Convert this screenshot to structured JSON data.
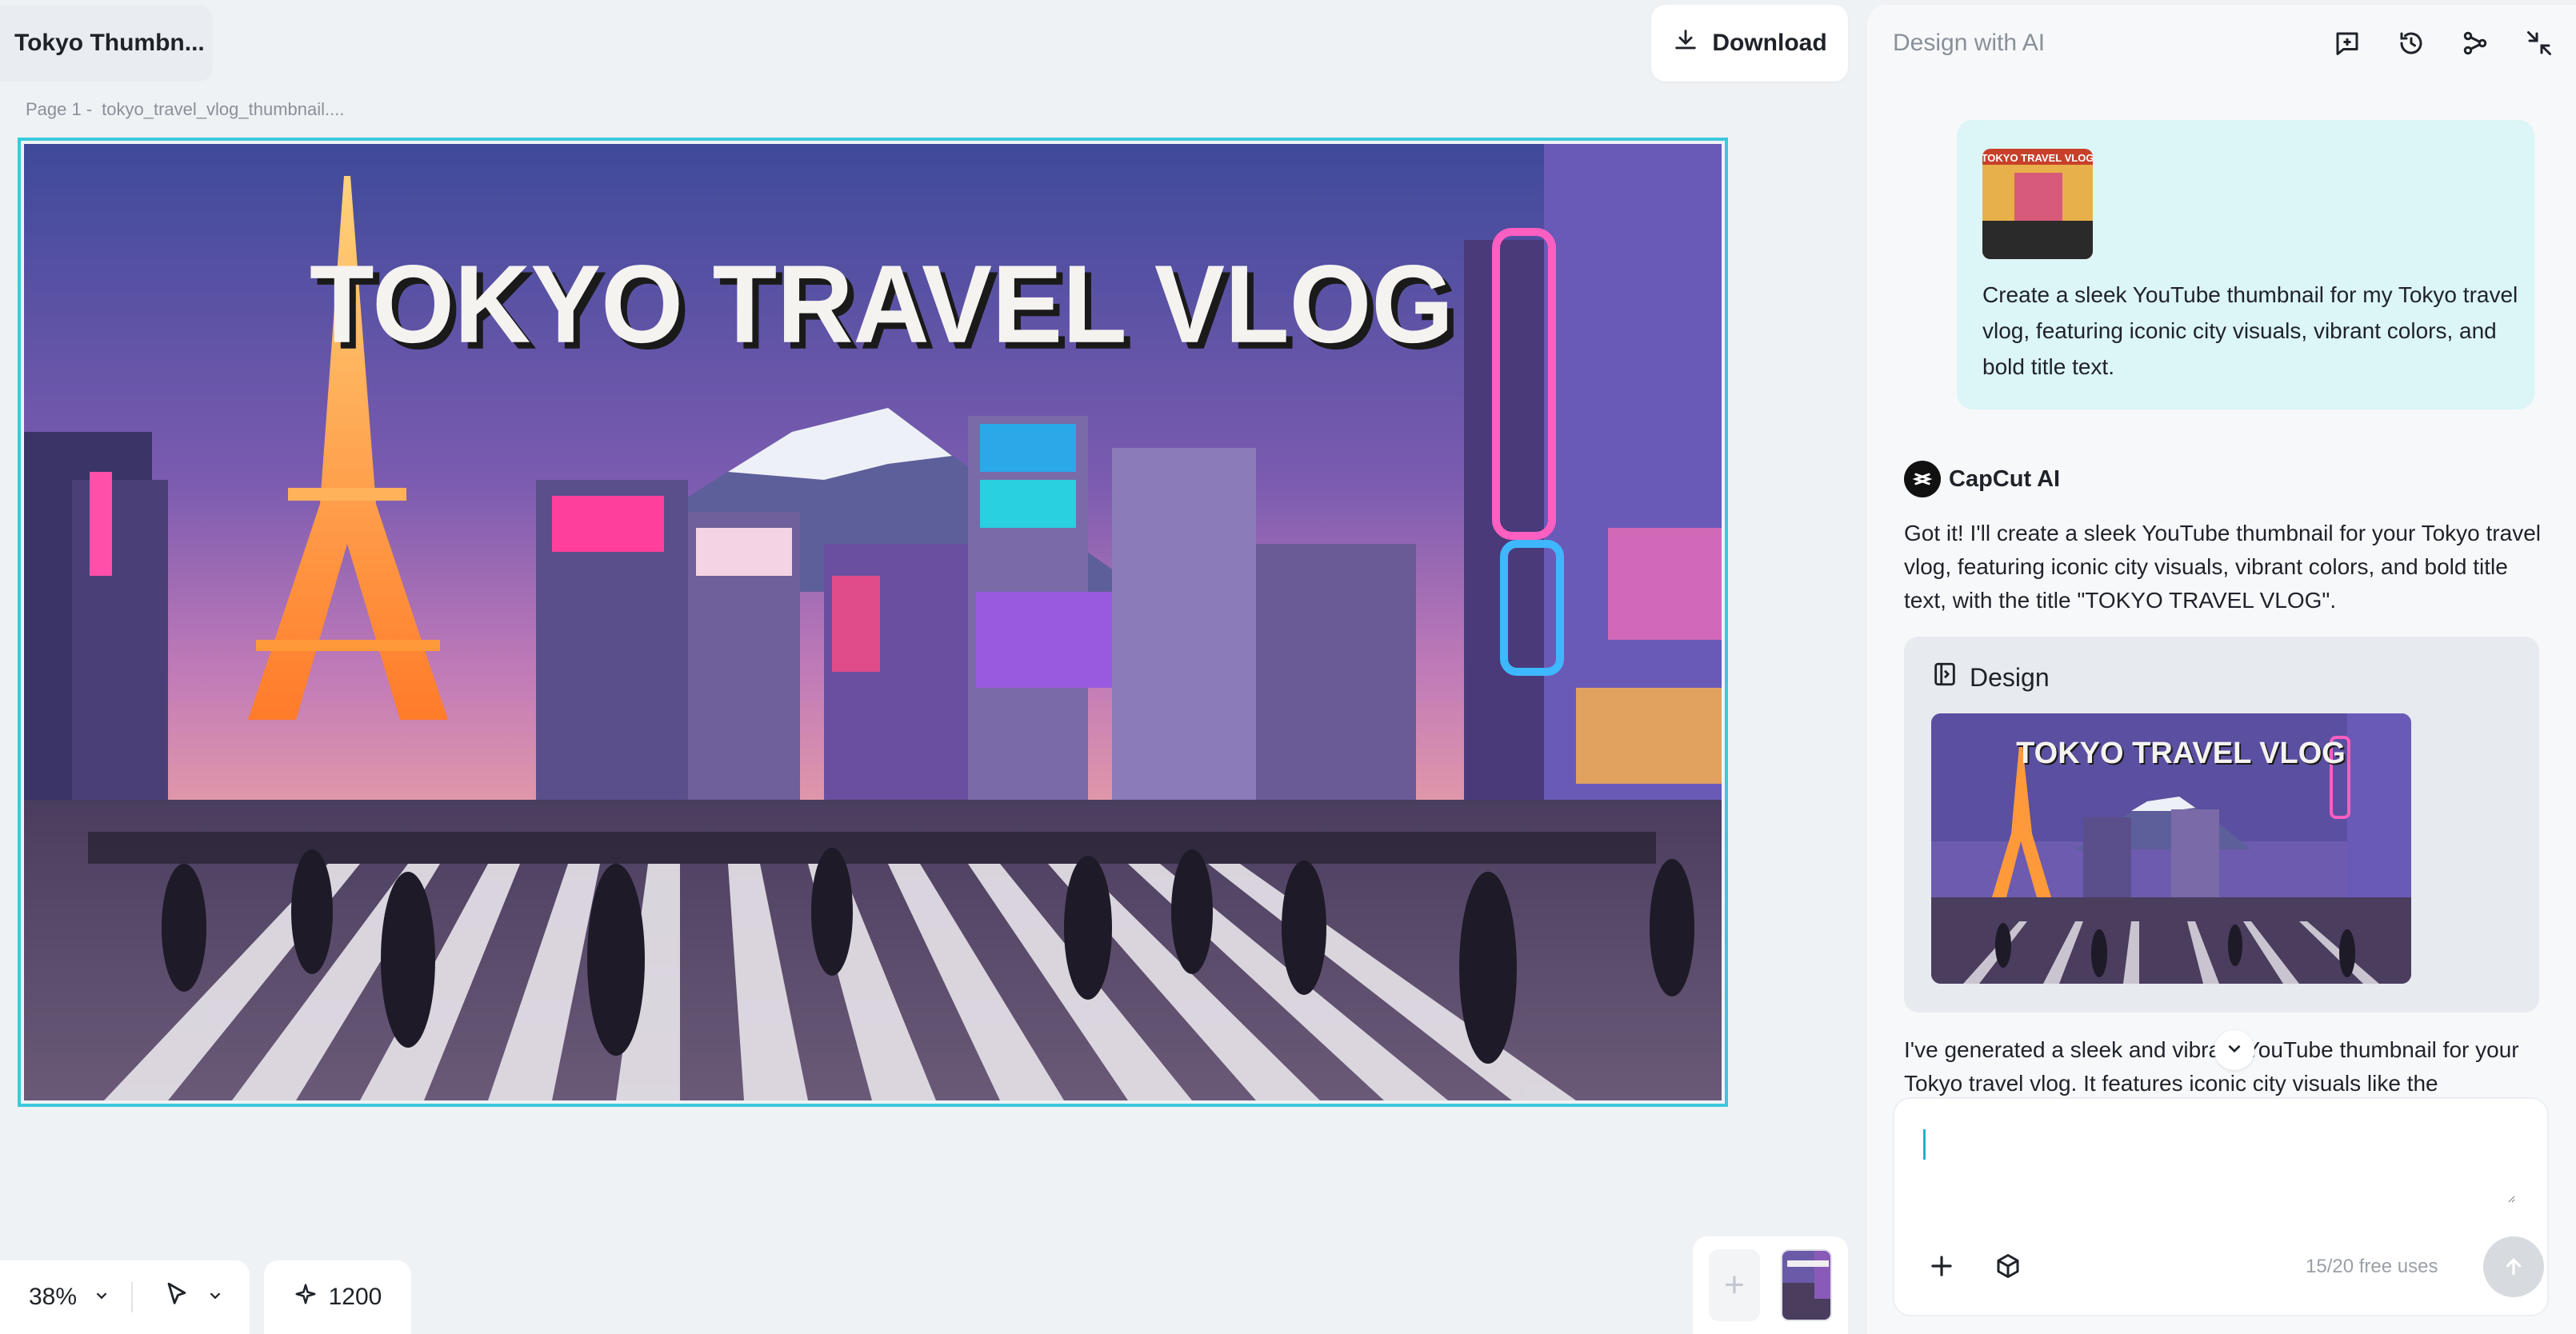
{
  "doc_title": "Tokyo Thumbn...",
  "download_label": "Download",
  "page_label": {
    "page": "Page 1 -",
    "filename": "tokyo_travel_vlog_thumbnail...."
  },
  "canvas": {
    "headline": "TOKYO TRAVEL VLOG"
  },
  "zoom": "38%",
  "credits": "1200",
  "ai_panel": {
    "title": "Design with AI",
    "user_prompt": "Create a sleek YouTube thumbnail for my Tokyo travel vlog, featuring iconic city visuals, vibrant colors, and bold title text.",
    "assistant_name": "CapCut AI",
    "assistant_reply": "Got it! I'll create a sleek YouTube thumbnail for your Tokyo travel vlog, featuring iconic city visuals, vibrant colors, and bold title text, with the title \"TOKYO TRAVEL VLOG\".",
    "design_card_title": "Design",
    "design_preview_title": "TOKYO TRAVEL VLOG",
    "user_thumb_title": "TOKYO TRAVEL VLOG",
    "assistant_reply_2": "I've generated a sleek and vibrant YouTube thumbnail for your Tokyo travel vlog. It features iconic city visuals like the",
    "composer_placeholder": "",
    "free_uses": "15/20 free uses"
  },
  "colors": {
    "accent": "#3cc8dc",
    "panel_bg": "#f6f8fa",
    "user_bubble": "#dcf5f6"
  }
}
